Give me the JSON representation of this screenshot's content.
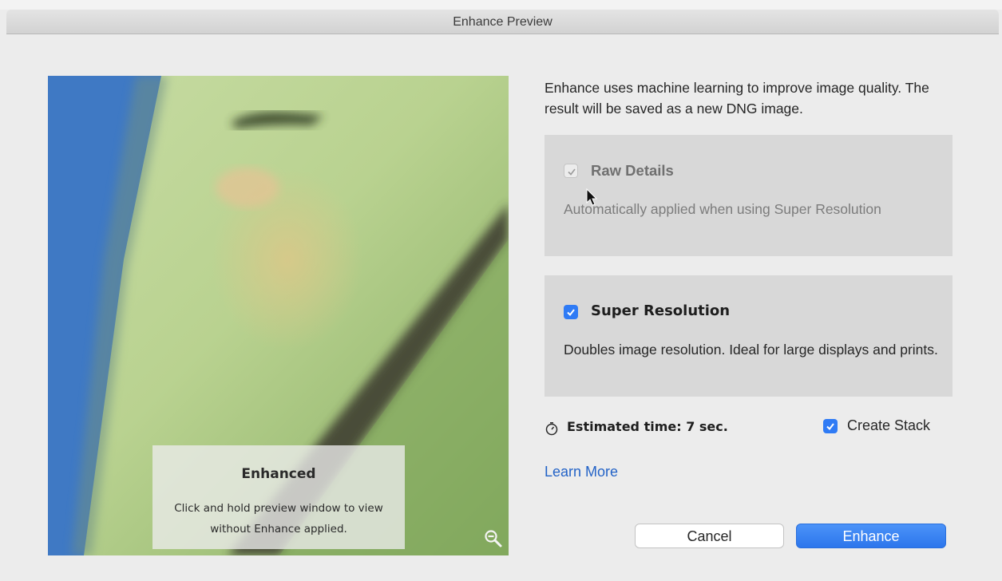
{
  "window": {
    "title": "Enhance Preview"
  },
  "preview": {
    "overlay_title": "Enhanced",
    "overlay_text": "Click and hold preview window to view without Enhance applied.",
    "zoom_icon": "zoom-out-icon"
  },
  "intro_text": "Enhance uses machine learning to improve image quality. The result will be saved as a new DNG image.",
  "raw_details": {
    "label": "Raw Details",
    "checked": true,
    "disabled": true,
    "description": "Automatically applied when using Super Resolution"
  },
  "super_resolution": {
    "label": "Super Resolution",
    "checked": true,
    "description": "Doubles image resolution. Ideal for large displays and prints."
  },
  "estimated_time": {
    "label": "Estimated time: 7 sec.",
    "icon": "stopwatch-icon"
  },
  "create_stack": {
    "label": "Create Stack",
    "checked": true
  },
  "learn_more": "Learn More",
  "buttons": {
    "cancel": "Cancel",
    "enhance": "Enhance"
  },
  "colors": {
    "accent": "#2f7bf5",
    "link": "#2363c7",
    "panel": "#d8d8d8"
  }
}
